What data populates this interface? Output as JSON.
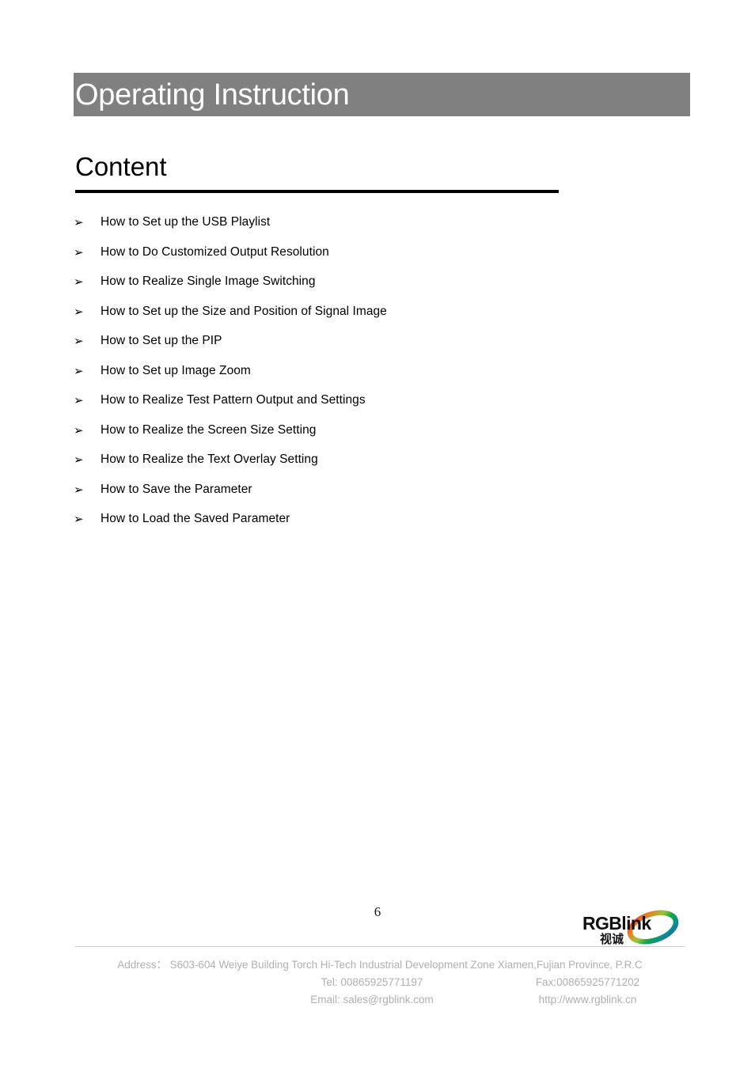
{
  "header": {
    "title": "Operating Instruction",
    "banner_color": "#808080"
  },
  "content": {
    "heading": "Content",
    "bullet_glyph": "➢",
    "items": [
      {
        "label": "How to Set up the USB Playlist"
      },
      {
        "label": "How to Do Customized Output Resolution"
      },
      {
        "label": "How to Realize Single Image Switching"
      },
      {
        "label": "How to Set up the Size and Position of Signal Image"
      },
      {
        "label": "How to Set up the PIP"
      },
      {
        "label": "How to Set up Image Zoom"
      },
      {
        "label": "How to Realize Test Pattern Output and Settings"
      },
      {
        "label": "How to Realize the Screen Size Setting"
      },
      {
        "label": "How to Realize the Text Overlay Setting"
      },
      {
        "label": "How to Save the Parameter"
      },
      {
        "label": "How to Load the Saved Parameter"
      }
    ]
  },
  "page_number": "6",
  "logo": {
    "wordmark": "RGBlink",
    "wordmark_cn": "视诚",
    "ring_colors": {
      "red": "#d8232a",
      "orange": "#ef7b22",
      "yellow_green": "#9cc63b",
      "green": "#13a24a",
      "teal": "#0b8f8f",
      "blue": "#1b62ab"
    }
  },
  "footer": {
    "address": "Address： S603-604 Weiye Building Torch Hi-Tech Industrial Development Zone Xiamen,Fujian Province, P.R.C",
    "tel": "Tel: 00865925771197",
    "fax": "Fax:00865925771202",
    "email": "Email: sales@rgblink.com",
    "website": "http://www.rgblink.cn",
    "text_color": "#b0b0b0"
  }
}
